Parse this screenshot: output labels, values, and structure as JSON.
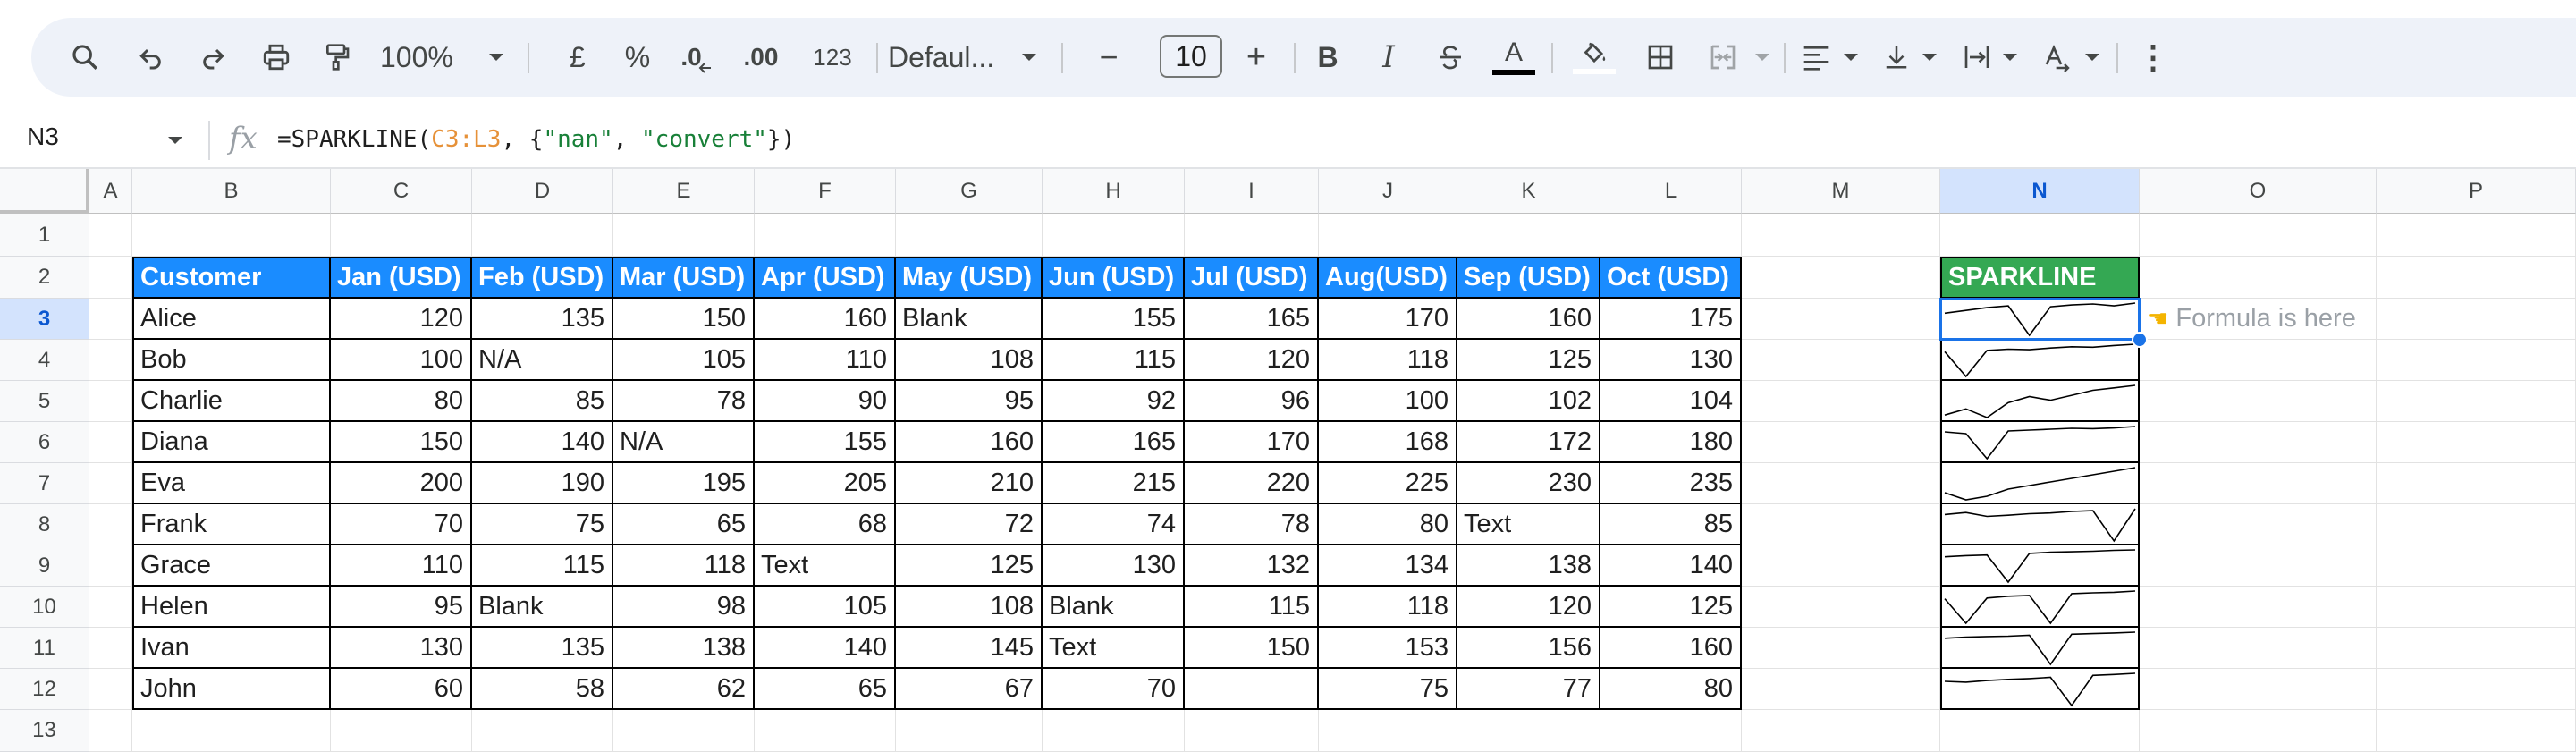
{
  "toolbar": {
    "zoom": "100%",
    "currency": "£",
    "percent": "%",
    "dec_decrease": ".0",
    "dec_increase": ".00",
    "number_format": "123",
    "font": "Defaul...",
    "font_size": "10",
    "minus": "−",
    "plus": "+",
    "bold": "B",
    "italic": "I",
    "text_color": "A",
    "more": "⋮"
  },
  "formula_bar": {
    "cell_ref": "N3",
    "fx": "fx",
    "f_prefix": "=SPARKLINE(",
    "f_range": "C3:L3",
    "f_mid": ", {",
    "f_opt1": "\"nan\"",
    "f_comma": ", ",
    "f_opt2": "\"convert\"",
    "f_suffix": "})"
  },
  "columns": [
    "A",
    "B",
    "C",
    "D",
    "E",
    "F",
    "G",
    "H",
    "I",
    "J",
    "K",
    "L",
    "M",
    "N",
    "O",
    "P"
  ],
  "rows": [
    "1",
    "2",
    "3",
    "4",
    "5",
    "6",
    "7",
    "8",
    "9",
    "10",
    "11",
    "12",
    "13"
  ],
  "table": {
    "headers": [
      "Customer",
      "Jan (USD)",
      "Feb (USD)",
      "Mar (USD)",
      "Apr (USD)",
      "May (USD)",
      "Jun (USD)",
      "Jul (USD)",
      "Aug(USD)",
      "Sep (USD)",
      "Oct (USD)"
    ],
    "rows": [
      [
        "Alice",
        "120",
        "135",
        "150",
        "160",
        "Blank",
        "155",
        "165",
        "170",
        "160",
        "175"
      ],
      [
        "Bob",
        "100",
        "N/A",
        "105",
        "110",
        "108",
        "115",
        "120",
        "118",
        "125",
        "130"
      ],
      [
        "Charlie",
        "80",
        "85",
        "78",
        "90",
        "95",
        "92",
        "96",
        "100",
        "102",
        "104"
      ],
      [
        "Diana",
        "150",
        "140",
        "N/A",
        "155",
        "160",
        "165",
        "170",
        "168",
        "172",
        "180"
      ],
      [
        "Eva",
        "200",
        "190",
        "195",
        "205",
        "210",
        "215",
        "220",
        "225",
        "230",
        "235"
      ],
      [
        "Frank",
        "70",
        "75",
        "65",
        "68",
        "72",
        "74",
        "78",
        "80",
        "Text",
        "85"
      ],
      [
        "Grace",
        "110",
        "115",
        "118",
        "Text",
        "125",
        "130",
        "132",
        "134",
        "138",
        "140"
      ],
      [
        "Helen",
        "95",
        "Blank",
        "98",
        "105",
        "108",
        "Blank",
        "115",
        "118",
        "120",
        "125"
      ],
      [
        "Ivan",
        "130",
        "135",
        "138",
        "140",
        "145",
        "Text",
        "150",
        "153",
        "156",
        "160"
      ],
      [
        "John",
        "60",
        "58",
        "62",
        "65",
        "67",
        "70",
        "",
        "75",
        "77",
        "80"
      ]
    ]
  },
  "sparkline": {
    "header": "SPARKLINE",
    "note": "Formula is here",
    "note_icon": "pointing-hand-icon"
  },
  "colors": {
    "header_blue": "#1a8cff",
    "sparkline_green": "#34a853",
    "selection_blue": "#1a73e8",
    "formula_range": "#e69138",
    "formula_string": "#188038"
  }
}
